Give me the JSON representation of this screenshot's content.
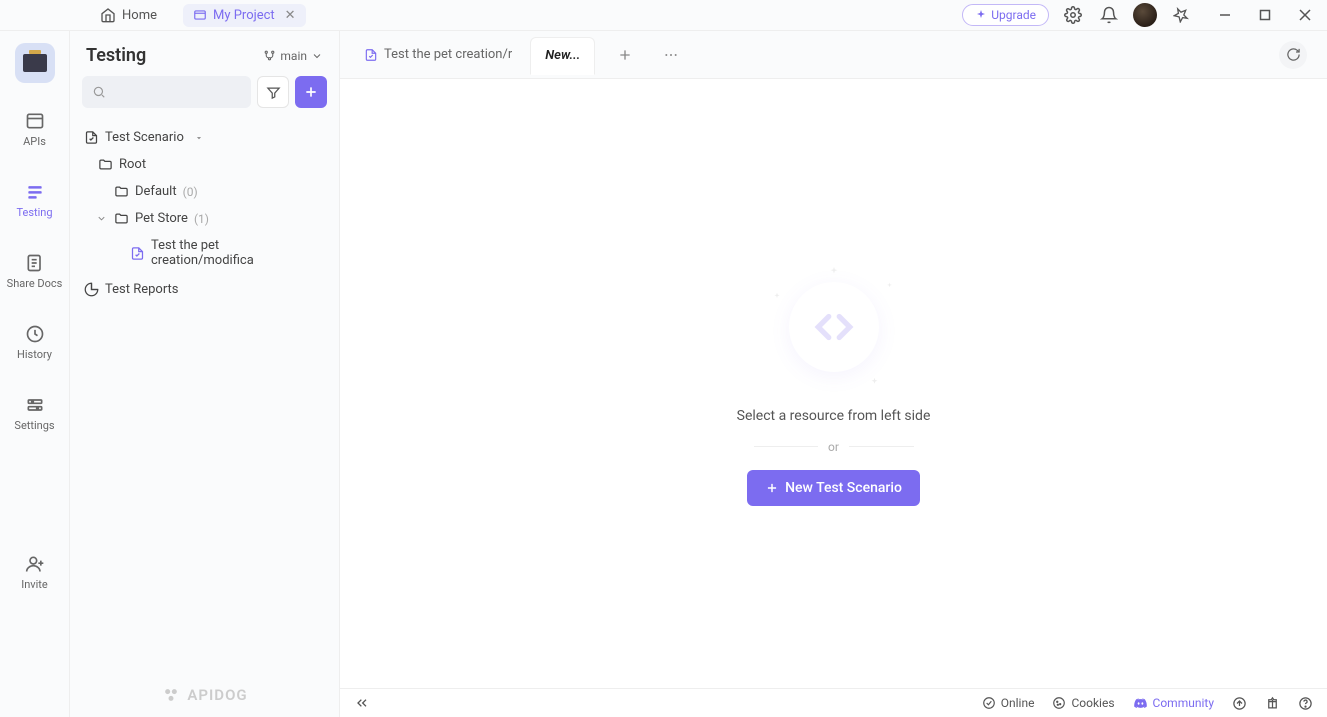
{
  "titlebar": {
    "home": "Home",
    "project": "My Project",
    "upgrade": "Upgrade"
  },
  "rail": {
    "apis": "APIs",
    "testing": "Testing",
    "share_docs": "Share Docs",
    "history": "History",
    "settings": "Settings",
    "invite": "Invite"
  },
  "sidebar": {
    "title": "Testing",
    "branch": "main",
    "search_placeholder": "",
    "scenario_label": "Test Scenario",
    "root": "Root",
    "default_folder": "Default",
    "default_count": "(0)",
    "petstore_folder": "Pet Store",
    "petstore_count": "(1)",
    "test_item": "Test the pet creation/modifica",
    "reports": "Test Reports",
    "brand": "APIDOG"
  },
  "tabs": {
    "t0": "Test the pet creation/r",
    "t1": "New..."
  },
  "empty": {
    "text": "Select a resource from left side",
    "or": "or",
    "button": "New Test Scenario"
  },
  "status": {
    "online": "Online",
    "cookies": "Cookies",
    "community": "Community"
  }
}
